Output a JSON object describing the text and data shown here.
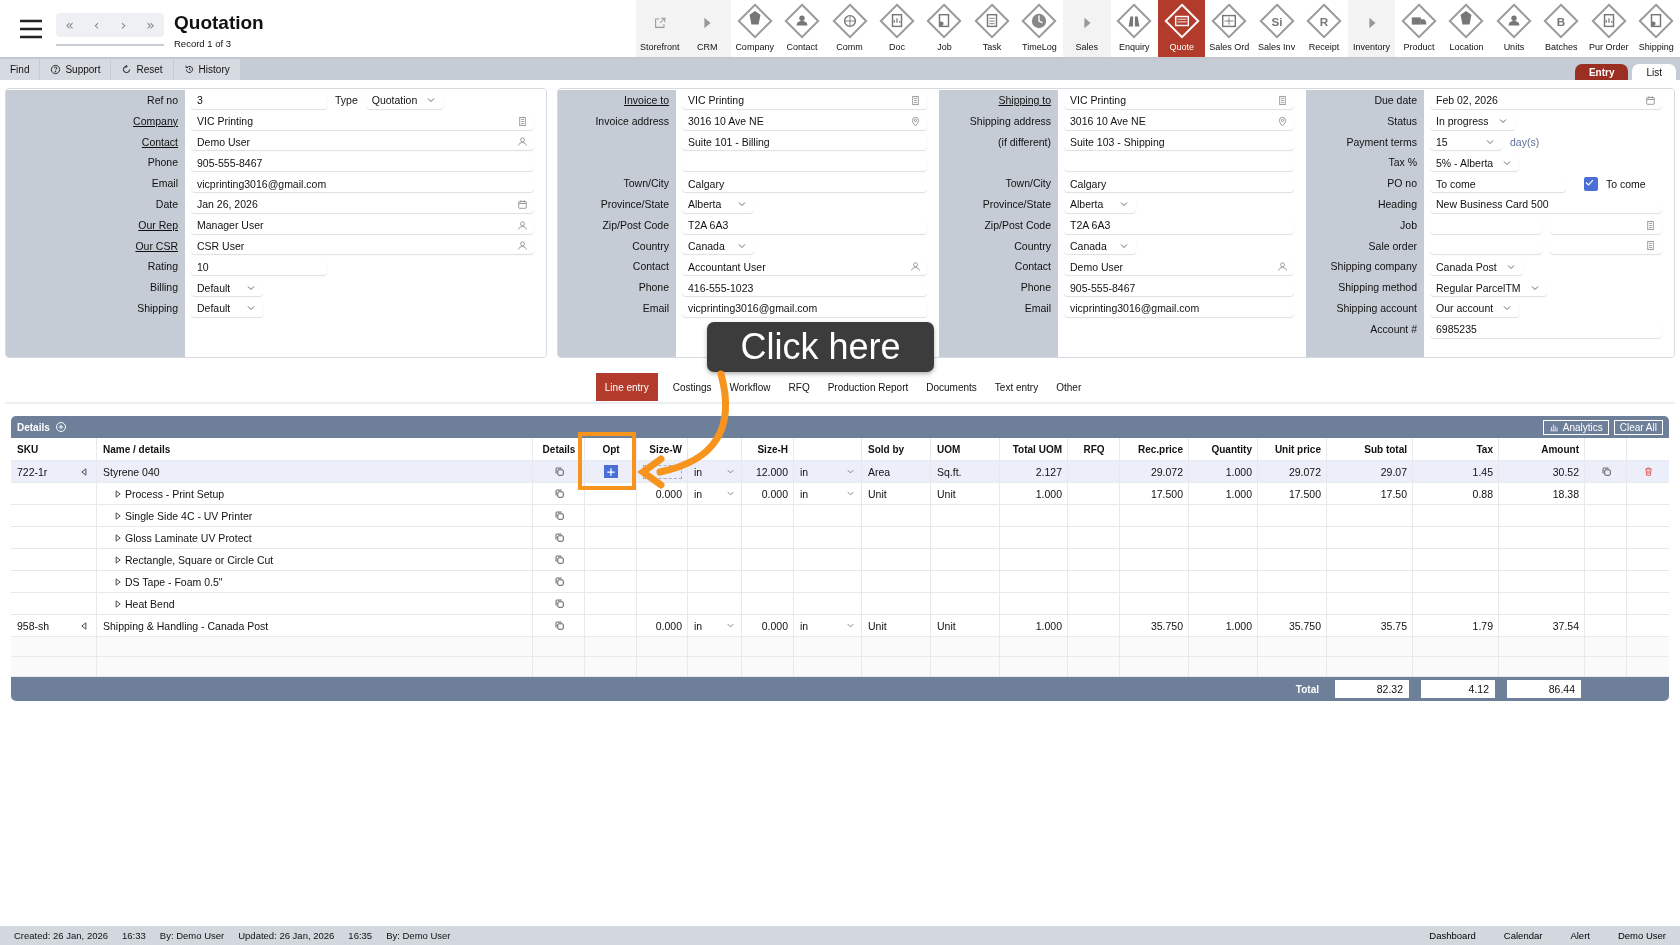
{
  "header": {
    "title": "Quotation",
    "subtitle": "Record 1 of 3"
  },
  "record_nav": [
    "«",
    "‹",
    "›",
    "»"
  ],
  "modules": [
    {
      "label": "Storefront",
      "kind": "link",
      "selected": false
    },
    {
      "label": "CRM",
      "kind": "group",
      "selected": false
    },
    {
      "label": "Company",
      "kind": "module",
      "selected": false
    },
    {
      "label": "Contact",
      "kind": "module",
      "selected": false
    },
    {
      "label": "Comm",
      "kind": "module",
      "selected": false
    },
    {
      "label": "Doc",
      "kind": "module",
      "selected": false
    },
    {
      "label": "Job",
      "kind": "module",
      "selected": false
    },
    {
      "label": "Task",
      "kind": "module",
      "selected": false
    },
    {
      "label": "TimeLog",
      "kind": "module",
      "selected": false
    },
    {
      "label": "Sales",
      "kind": "group",
      "selected": false
    },
    {
      "label": "Enquiry",
      "kind": "module",
      "selected": false
    },
    {
      "label": "Quote",
      "kind": "module",
      "selected": true
    },
    {
      "label": "Sales Ord",
      "kind": "module",
      "selected": false
    },
    {
      "label": "Sales Inv",
      "kind": "module",
      "selected": false,
      "glyph": "Si"
    },
    {
      "label": "Receipt",
      "kind": "module",
      "selected": false,
      "glyph": "R"
    },
    {
      "label": "Inventory",
      "kind": "group",
      "selected": false
    },
    {
      "label": "Product",
      "kind": "module",
      "selected": false
    },
    {
      "label": "Location",
      "kind": "module",
      "selected": false
    },
    {
      "label": "Units",
      "kind": "module",
      "selected": false
    },
    {
      "label": "Batches",
      "kind": "module",
      "selected": false,
      "glyph": "B"
    },
    {
      "label": "Pur Order",
      "kind": "module",
      "selected": false
    },
    {
      "label": "Shipping",
      "kind": "module",
      "selected": false
    }
  ],
  "actions": [
    {
      "label": "Find",
      "kind": "plain"
    },
    {
      "label": "Support",
      "kind": "help"
    },
    {
      "label": "Reset",
      "kind": "reset"
    },
    {
      "label": "History",
      "kind": "history"
    }
  ],
  "views": [
    {
      "label": "Entry",
      "selected": true
    },
    {
      "label": "List",
      "selected": false
    }
  ],
  "sections": [
    {
      "fields": [
        {
          "label": "Ref no",
          "value": "3",
          "kind": "short",
          "link": false,
          "extra": {
            "label": "Type",
            "value": "Quotation"
          }
        },
        {
          "label": "Company",
          "value": "VIC Printing",
          "kind": "lookup",
          "link": true
        },
        {
          "label": "Contact",
          "value": "Demo User",
          "kind": "person",
          "link": true
        },
        {
          "label": "Phone",
          "value": "905-555-8467",
          "kind": "text",
          "link": false
        },
        {
          "label": "Email",
          "value": "vicprinting3016@gmail.com",
          "kind": "text",
          "link": false
        },
        {
          "label": "Date",
          "value": "Jan 26, 2026",
          "kind": "date",
          "link": false
        },
        {
          "label": "Our Rep",
          "value": "Manager User",
          "kind": "person",
          "link": true
        },
        {
          "label": "Our CSR",
          "value": "CSR User",
          "kind": "person",
          "link": true
        },
        {
          "label": "Rating",
          "value": "10",
          "kind": "short",
          "link": false
        },
        {
          "label": "Billing",
          "value": "Default",
          "kind": "select",
          "link": false
        },
        {
          "label": "Shipping",
          "value": "Default",
          "kind": "select",
          "link": false
        }
      ]
    },
    {
      "fields": [
        {
          "label": "Invoice to",
          "value": "VIC Printing",
          "kind": "lookup",
          "link": true
        },
        {
          "label": "Invoice address",
          "value": "3016 10 Ave NE",
          "kind": "pin",
          "link": false
        },
        {
          "value": "Suite 101 - Billing",
          "kind": "text"
        },
        {
          "kind": "text"
        },
        {
          "label": "Town/City",
          "value": "Calgary",
          "kind": "text",
          "link": false
        },
        {
          "label": "Province/State",
          "value": "Alberta",
          "kind": "select",
          "link": false
        },
        {
          "label": "Zip/Post Code",
          "value": "T2A 6A3",
          "kind": "text",
          "link": false
        },
        {
          "label": "Country",
          "value": "Canada",
          "kind": "select",
          "link": false
        },
        {
          "label": "Contact",
          "value": "Accountant User",
          "kind": "person",
          "link": false
        },
        {
          "label": "Phone",
          "value": "416-555-1023",
          "kind": "text",
          "link": false
        },
        {
          "label": "Email",
          "value": "vicprinting3016@gmail.com",
          "kind": "text",
          "link": false
        }
      ]
    },
    {
      "fields": [
        {
          "label": "Shipping to",
          "value": "VIC Printing",
          "kind": "lookup",
          "link": true
        },
        {
          "label": "Shipping address",
          "value": "3016 10 Ave NE",
          "kind": "pin",
          "link": false
        },
        {
          "label": "(if different)",
          "value": "Suite 103 - Shipping",
          "kind": "text",
          "link": false
        },
        {
          "kind": "text"
        },
        {
          "label": "Town/City",
          "value": "Calgary",
          "kind": "text",
          "link": false
        },
        {
          "label": "Province/State",
          "value": "Alberta",
          "kind": "select",
          "link": false
        },
        {
          "label": "Zip/Post Code",
          "value": "T2A 6A3",
          "kind": "text",
          "link": false
        },
        {
          "label": "Country",
          "value": "Canada",
          "kind": "select",
          "link": false
        },
        {
          "label": "Contact",
          "value": "Demo User",
          "kind": "person",
          "link": false
        },
        {
          "label": "Phone",
          "value": "905-555-8467",
          "kind": "text",
          "link": false
        },
        {
          "label": "Email",
          "value": "vicprinting3016@gmail.com",
          "kind": "text",
          "link": false
        }
      ]
    },
    {
      "fields": [
        {
          "label": "Due date",
          "value": "Feb 02, 2026",
          "kind": "date",
          "link": false
        },
        {
          "label": "Status",
          "value": "In progress",
          "kind": "select",
          "link": false
        },
        {
          "label": "Payment terms",
          "value": "15",
          "kind": "select",
          "link": false,
          "suffix": "day(s)"
        },
        {
          "label": "Tax %",
          "value": "5% - Alberta",
          "kind": "select",
          "link": false
        },
        {
          "label": "PO no",
          "value": "To come",
          "kind": "short",
          "link": false,
          "checkbox": {
            "label": "To come",
            "checked": true
          }
        },
        {
          "label": "Heading",
          "value": "New Business Card 500",
          "kind": "text",
          "link": false
        },
        {
          "label": "Job",
          "kind": "pair",
          "link": false
        },
        {
          "label": "Sale order",
          "kind": "pair",
          "link": false
        },
        {
          "label": "Shipping company",
          "value": "Canada Post",
          "kind": "select",
          "link": false
        },
        {
          "label": "Shipping method",
          "value": "Regular ParcelTM",
          "kind": "select",
          "link": false
        },
        {
          "label": "Shipping account",
          "value": "Our account",
          "kind": "select",
          "link": false
        },
        {
          "label": "Account #",
          "value": "6985235",
          "kind": "text",
          "link": false
        }
      ]
    }
  ],
  "tabs": [
    {
      "label": "Line entry",
      "selected": true
    },
    {
      "label": "Costings",
      "selected": false
    },
    {
      "label": "Workflow",
      "selected": false
    },
    {
      "label": "RFQ",
      "selected": false
    },
    {
      "label": "Production Report",
      "selected": false
    },
    {
      "label": "Documents",
      "selected": false
    },
    {
      "label": "Text entry",
      "selected": false
    },
    {
      "label": "Other",
      "selected": false
    }
  ],
  "table": {
    "title": "Details",
    "buttons": [
      {
        "label": "Analytics",
        "kind": "analytics"
      },
      {
        "label": "Clear All",
        "kind": "plain"
      }
    ],
    "columns": [
      "SKU",
      "Name / details",
      "Details",
      "Opt",
      "Size-W",
      "Size-H",
      "Sold by",
      "UOM",
      "Total UOM",
      "RFQ",
      "Rec.price",
      "Quantity",
      "Unit price",
      "Sub total",
      "Tax",
      "Amount"
    ],
    "rows": [
      {
        "sku": "722-1r",
        "name": "Styrene 040",
        "selected": true,
        "unit_w": "in",
        "size_h": "12.000",
        "unit_h": "in",
        "sold_by": "Area",
        "uom": "Sq.ft.",
        "total_uom": "2.127",
        "rec_price": "29.072",
        "quantity": "1.000",
        "unit_price": "29.072",
        "sub_total": "29.07",
        "tax": "1.45",
        "amount": "30.52",
        "children": [
          {
            "name": "Process - Print Setup",
            "selected": false,
            "size_w": "0.000",
            "unit_w": "in",
            "size_h": "0.000",
            "unit_h": "in",
            "sold_by": "Unit",
            "uom": "Unit",
            "total_uom": "1.000",
            "rec_price": "17.500",
            "quantity": "1.000",
            "unit_price": "17.500",
            "sub_total": "17.50",
            "tax": "0.88",
            "amount": "18.38"
          },
          {
            "name": "Single Side 4C - UV Printer",
            "selected": false
          },
          {
            "name": "Gloss Laminate UV Protect",
            "selected": false
          },
          {
            "name": "Rectangle, Square or Circle Cut",
            "selected": false
          },
          {
            "name": "DS Tape - Foam 0.5\"",
            "selected": false
          },
          {
            "name": "Heat Bend",
            "selected": false
          }
        ]
      },
      {
        "sku": "958-sh",
        "name": "Shipping & Handling - Canada Post",
        "selected": false,
        "size_w": "0.000",
        "unit_w": "in",
        "size_h": "0.000",
        "unit_h": "in",
        "sold_by": "Unit",
        "uom": "Unit",
        "total_uom": "1.000",
        "rec_price": "35.750",
        "quantity": "1.000",
        "unit_price": "35.750",
        "sub_total": "35.75",
        "tax": "1.79",
        "amount": "37.54"
      }
    ],
    "total_label": "Total",
    "totals": [
      "82.32",
      "4.12",
      "86.44"
    ]
  },
  "status": {
    "left": [
      "Created: 26 Jan, 2026",
      "16:33",
      "By: Demo User",
      "Updated: 26 Jan, 2026",
      "16:35",
      "By: Demo User"
    ],
    "right": [
      "Dashboard",
      "Calendar",
      "Alert",
      "Demo User"
    ]
  },
  "callout": {
    "text": "Click here"
  }
}
